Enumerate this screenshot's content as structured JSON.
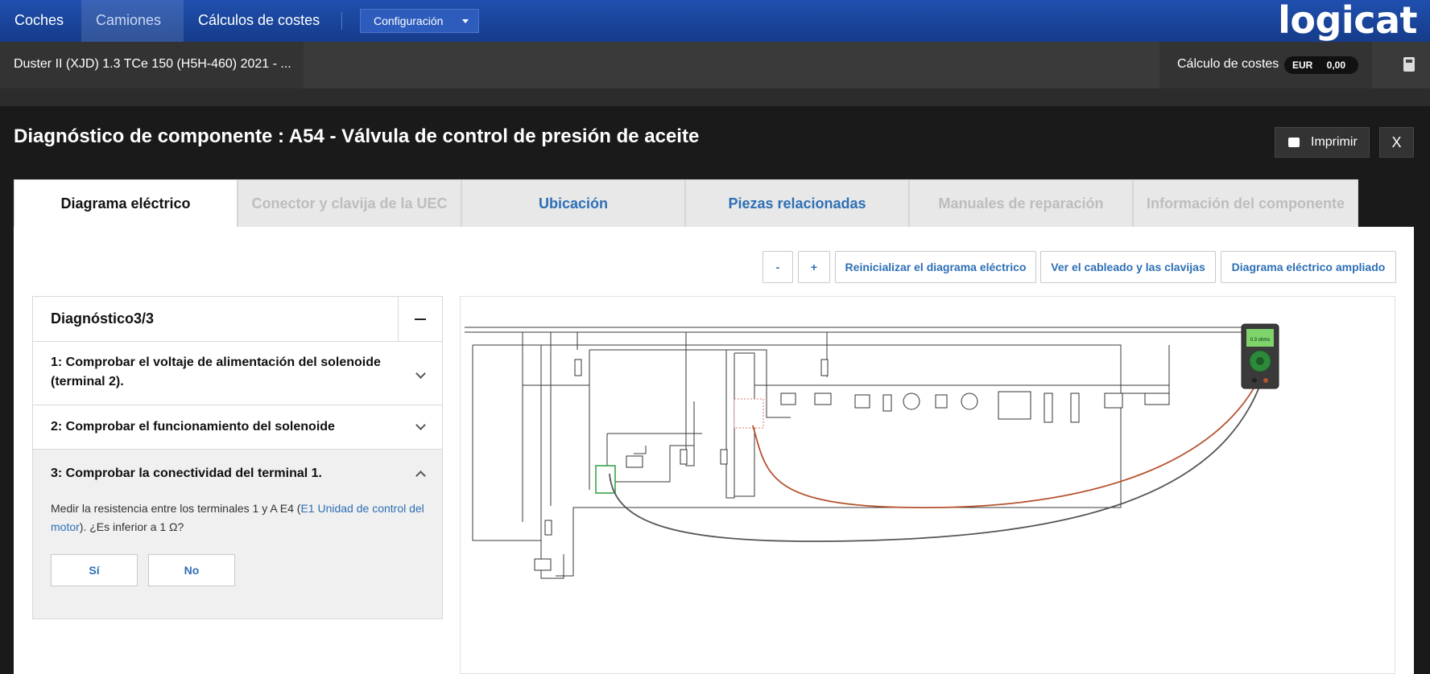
{
  "nav": {
    "items": [
      {
        "label": "Coches",
        "active": false
      },
      {
        "label": "Camiones",
        "active": true
      },
      {
        "label": "Cálculos de costes",
        "active": false
      }
    ],
    "config_label": "Configuración",
    "logo": "logicat"
  },
  "subbar": {
    "vehicle": "Duster II (XJD) 1.3 TCe 150 (H5H-460) 2021 - ...",
    "cost_label": "Cálculo de costes",
    "currency": "EUR",
    "cost_value": "0,00"
  },
  "header": {
    "title": "Diagnóstico de componente : A54 - Válvula de control de presión de aceite",
    "print_label": "Imprimir",
    "close_label": "X"
  },
  "tabs": [
    {
      "label": "Diagrama eléctrico",
      "state": "active"
    },
    {
      "label": "Conector y clavija de la UEC",
      "state": "disabled"
    },
    {
      "label": "Ubicación",
      "state": "link"
    },
    {
      "label": "Piezas relacionadas",
      "state": "link"
    },
    {
      "label": "Manuales de reparación",
      "state": "disabled"
    },
    {
      "label": "Información del componente",
      "state": "disabled"
    }
  ],
  "toolbar": {
    "zoom_out": "-",
    "zoom_in": "+",
    "reset": "Reinicializar el diagrama eléctrico",
    "wiring": "Ver el cableado y las clavijas",
    "enlarged": "Diagrama eléctrico ampliado"
  },
  "diagnosis": {
    "title": "Diagnóstico3/3",
    "steps": [
      {
        "title": "1: Comprobar el voltaje de alimentación del solenoide (terminal 2)."
      },
      {
        "title": "2: Comprobar el funcionamiento del solenoide"
      },
      {
        "title": "3: Comprobar la conectividad del terminal 1.",
        "desc_prefix": "Medir la resistencia entre los terminales 1 y A E4 (",
        "desc_link": "E1 Unidad de control del motor",
        "desc_suffix": "). ¿Es inferior a 1 Ω?",
        "yes": "Sí",
        "no": "No"
      }
    ]
  },
  "diagram": {
    "meter_reading": "0.3 ohms",
    "colors": {
      "wire": "#333333",
      "probe_red": "#b5532e",
      "probe_black": "#555555",
      "component": "#2e9e3e",
      "highlight": "#e07070"
    }
  }
}
